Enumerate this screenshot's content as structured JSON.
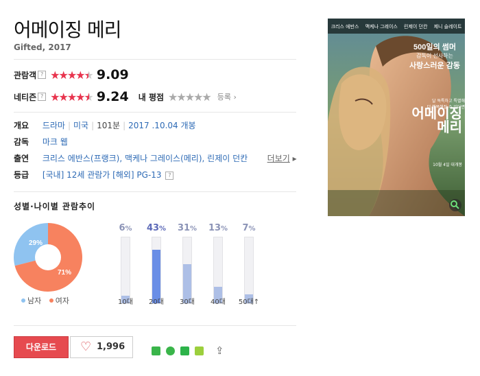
{
  "movie": {
    "title": "어메이징 메리",
    "subtitle": "Gifted, 2017"
  },
  "ratings": {
    "audience_label": "관람객",
    "audience_score": "9.09",
    "netizen_label": "네티즌",
    "netizen_score": "9.24",
    "my_rating_label": "내 평점",
    "register_label": "등록",
    "help_glyph": "?"
  },
  "meta": {
    "overview_label": "개요",
    "genre": "드라마",
    "country": "미국",
    "runtime": "101분",
    "release": "2017 .10.04 개봉",
    "director_label": "감독",
    "director": "마크 웹",
    "cast_label": "출연",
    "cast": "크리스 에반스(프랭크), 맥케나 그레이스(메리), 린제이 던칸",
    "more_label": "더보기",
    "rating_label": "등급",
    "rating_domestic": "[국내] 12세 관람가",
    "rating_foreign": "[해외] PG-13"
  },
  "trend": {
    "title": "성별·나이별 관람추이",
    "male_label": "남자",
    "female_label": "여자",
    "male_pct_text": "29%",
    "female_pct_text": "71%",
    "male_color": "#8fc3f0",
    "female_color": "#f7825f",
    "ages": [
      {
        "label": "10대",
        "value": 6,
        "text": "6"
      },
      {
        "label": "20대",
        "value": 43,
        "text": "43"
      },
      {
        "label": "30대",
        "value": 31,
        "text": "31"
      },
      {
        "label": "40대",
        "value": 13,
        "text": "13"
      },
      {
        "label": "50대↑",
        "value": 7,
        "text": "7"
      }
    ],
    "pct_sign": "%"
  },
  "actions": {
    "download_label": "다운로드",
    "like_count": "1,996"
  },
  "poster": {
    "top_names": [
      "크리스 에반스",
      "맥케나 그레이스",
      "린제이 던칸",
      "제니 슬레이트"
    ],
    "tagline_highlight": "500일의 썸머",
    "tagline_line2": "감독이 선사하는",
    "tagline_line3": "사랑스러운 감동",
    "poster_title_line1": "어메이징",
    "poster_title_line2": "메리",
    "small_copy1": "달 독특하고 특별해",
    "small_copy2": "더 행복해질 수 있다면",
    "release_text": "10월 4일 대개봉"
  },
  "colors": {
    "star_red": "#e8344e",
    "link_blue": "#2d6ab5",
    "download_red": "#e64a4f",
    "bar_highlight": "#6a8ee6",
    "bar_default": "#adbfe6"
  }
}
